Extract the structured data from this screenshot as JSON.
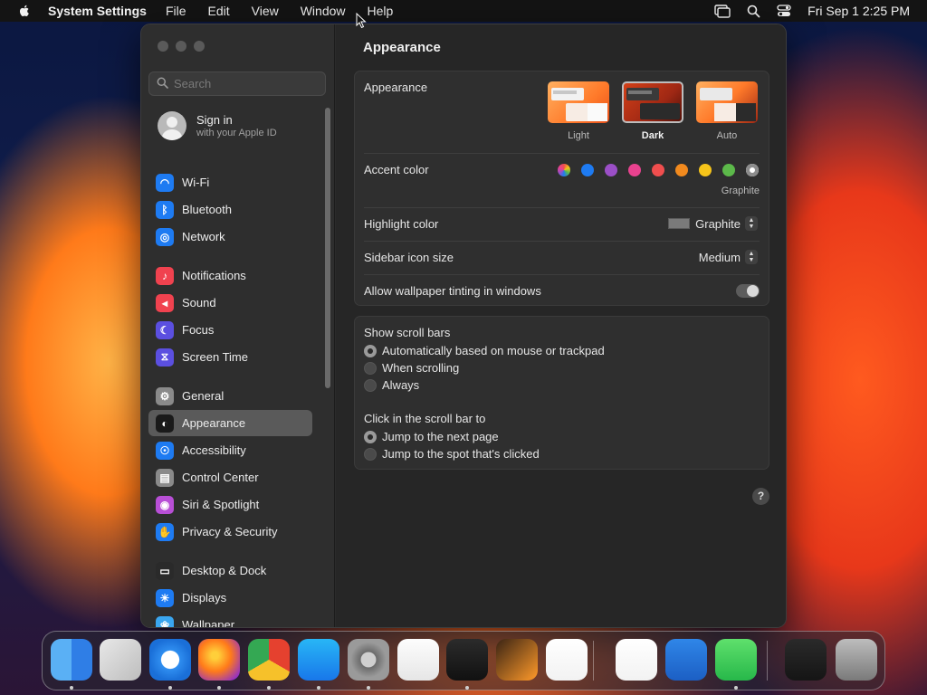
{
  "menubar": {
    "app_name": "System Settings",
    "menus": [
      "File",
      "Edit",
      "View",
      "Window",
      "Help"
    ],
    "datetime": "Fri Sep 1  2:25 PM"
  },
  "sidebar": {
    "search_placeholder": "Search",
    "signin_title": "Sign in",
    "signin_subtitle": "with your Apple ID",
    "items": [
      {
        "label": "Wi-Fi",
        "icon": "wifi-icon",
        "color": "#1e7bf2"
      },
      {
        "label": "Bluetooth",
        "icon": "bluetooth-icon",
        "color": "#1e7bf2"
      },
      {
        "label": "Network",
        "icon": "globe-icon",
        "color": "#1e7bf2"
      },
      {
        "label": "Notifications",
        "icon": "bell-icon",
        "color": "#f0424f"
      },
      {
        "label": "Sound",
        "icon": "speaker-icon",
        "color": "#f0424f"
      },
      {
        "label": "Focus",
        "icon": "moon-icon",
        "color": "#5b4fe0"
      },
      {
        "label": "Screen Time",
        "icon": "hourglass-icon",
        "color": "#5b4fe0"
      },
      {
        "label": "General",
        "icon": "gear-icon",
        "color": "#8a8a8a"
      },
      {
        "label": "Appearance",
        "icon": "appearance-icon",
        "color": "#1a1a1a"
      },
      {
        "label": "Accessibility",
        "icon": "accessibility-icon",
        "color": "#1e7bf2"
      },
      {
        "label": "Control Center",
        "icon": "control-center-icon",
        "color": "#8a8a8a"
      },
      {
        "label": "Siri & Spotlight",
        "icon": "siri-icon",
        "color": "#b84fd6"
      },
      {
        "label": "Privacy & Security",
        "icon": "hand-icon",
        "color": "#1e7bf2"
      },
      {
        "label": "Desktop & Dock",
        "icon": "dock-icon",
        "color": "#2a2a2a"
      },
      {
        "label": "Displays",
        "icon": "sun-icon",
        "color": "#1e7bf2"
      },
      {
        "label": "Wallpaper",
        "icon": "flower-icon",
        "color": "#3aa6f0"
      }
    ],
    "selected": "Appearance"
  },
  "content": {
    "title": "Appearance",
    "appearance": {
      "label": "Appearance",
      "options": [
        "Light",
        "Dark",
        "Auto"
      ],
      "selected": "Dark"
    },
    "accent": {
      "label": "Accent color",
      "selected_name": "Graphite",
      "colors": [
        "multicolor",
        "#1e7bf2",
        "#9b4fc7",
        "#e9428f",
        "#f04e4e",
        "#f28a1e",
        "#f6c41a",
        "#5cb94a",
        "#8c8c8c"
      ]
    },
    "highlight": {
      "label": "Highlight color",
      "value": "Graphite"
    },
    "icon_size": {
      "label": "Sidebar icon size",
      "value": "Medium"
    },
    "tinting": {
      "label": "Allow wallpaper tinting in windows",
      "on": false
    },
    "scroll_bars": {
      "label": "Show scroll bars",
      "options": [
        "Automatically based on mouse or trackpad",
        "When scrolling",
        "Always"
      ],
      "selected": 0
    },
    "click_scroll": {
      "label": "Click in the scroll bar to",
      "options": [
        "Jump to the next page",
        "Jump to the spot that's clicked"
      ],
      "selected": 0
    },
    "help": "?"
  },
  "dock": {
    "apps": [
      "finder-icon",
      "launchpad-icon",
      "safari-icon",
      "firefox-icon",
      "chrome-icon",
      "app-store-icon",
      "system-settings-icon",
      "textedit-icon",
      "terminal-icon",
      "garageband-icon",
      "vscode-icon",
      "visual-studio-icon",
      "weather-icon",
      "messages-icon",
      "preview-icon",
      "trash-icon"
    ]
  }
}
